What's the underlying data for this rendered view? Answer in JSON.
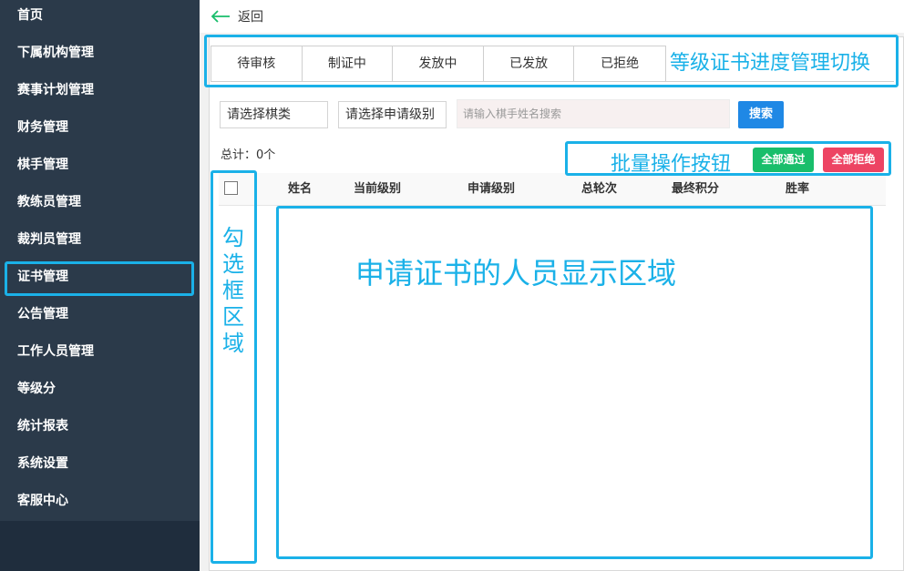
{
  "sidebar": {
    "items": [
      {
        "label": "首页"
      },
      {
        "label": "下属机构管理"
      },
      {
        "label": "赛事计划管理"
      },
      {
        "label": "财务管理"
      },
      {
        "label": "棋手管理"
      },
      {
        "label": "教练员管理"
      },
      {
        "label": "裁判员管理"
      },
      {
        "label": "证书管理",
        "active": true
      },
      {
        "label": "公告管理"
      },
      {
        "label": "工作人员管理"
      },
      {
        "label": "等级分"
      },
      {
        "label": "统计报表"
      },
      {
        "label": "系统设置"
      },
      {
        "label": "客服中心"
      }
    ]
  },
  "header": {
    "back_label": "返回",
    "back_icon": "arrow-left-icon"
  },
  "tabs": [
    {
      "label": "待审核"
    },
    {
      "label": "制证中"
    },
    {
      "label": "发放中"
    },
    {
      "label": "已发放"
    },
    {
      "label": "已拒绝"
    }
  ],
  "filters": {
    "chess_type": "请选择棋类",
    "level": "请选择申请级别",
    "search_placeholder": "请输入棋手姓名搜索",
    "search_button": "搜索"
  },
  "summary": {
    "total_label": "总计：0个"
  },
  "batch": {
    "pass_all": "全部通过",
    "reject_all": "全部拒绝"
  },
  "table": {
    "columns": [
      "姓名",
      "当前级别",
      "申请级别",
      "总轮次",
      "最终积分",
      "胜率"
    ],
    "rows": []
  },
  "annotations": {
    "tabs_note": "等级证书进度管理切换",
    "batch_note": "批量操作按钮",
    "checkbox_note": [
      "勾",
      "选",
      "框",
      "区",
      "域"
    ],
    "list_note": "申请证书的人员显示区域"
  },
  "colors": {
    "sidebar_bg": "#2b3a4a",
    "annotation": "#1ab1e8",
    "search_button": "#1f88e5",
    "pass_button": "#19be6b",
    "reject_button": "#ed4463",
    "back_arrow": "#19be6b"
  }
}
